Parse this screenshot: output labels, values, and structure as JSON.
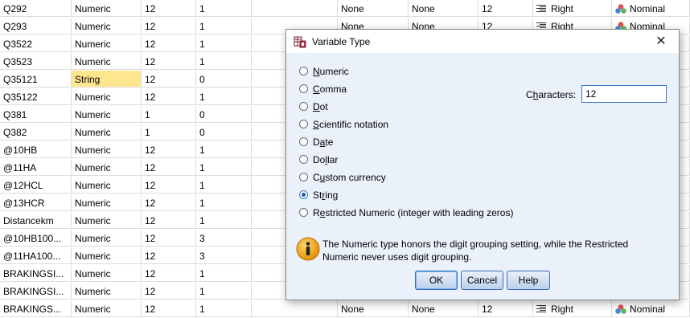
{
  "grid": {
    "rows": [
      {
        "name": "Q292",
        "type": "Numeric",
        "width": "12",
        "decimals": "1",
        "values": "None",
        "missing": "None",
        "columns": "12",
        "align": "Right",
        "measure": "Nominal"
      },
      {
        "name": "Q293",
        "type": "Numeric",
        "width": "12",
        "decimals": "1",
        "values": "None",
        "missing": "None",
        "columns": "12",
        "align": "Right",
        "measure": "Nominal"
      },
      {
        "name": "Q3522",
        "type": "Numeric",
        "width": "12",
        "decimals": "1"
      },
      {
        "name": "Q3523",
        "type": "Numeric",
        "width": "12",
        "decimals": "1"
      },
      {
        "name": "Q35121",
        "type": "String",
        "width": "12",
        "decimals": "0"
      },
      {
        "name": "Q35122",
        "type": "Numeric",
        "width": "12",
        "decimals": "1"
      },
      {
        "name": "Q381",
        "type": "Numeric",
        "width": "1",
        "decimals": "0"
      },
      {
        "name": "Q382",
        "type": "Numeric",
        "width": "1",
        "decimals": "0"
      },
      {
        "name": "@10HB",
        "type": "Numeric",
        "width": "12",
        "decimals": "1"
      },
      {
        "name": "@11HA",
        "type": "Numeric",
        "width": "12",
        "decimals": "1"
      },
      {
        "name": "@12HCL",
        "type": "Numeric",
        "width": "12",
        "decimals": "1"
      },
      {
        "name": "@13HCR",
        "type": "Numeric",
        "width": "12",
        "decimals": "1"
      },
      {
        "name": "Distancekm",
        "type": "Numeric",
        "width": "12",
        "decimals": "1"
      },
      {
        "name": "@10HB100...",
        "type": "Numeric",
        "width": "12",
        "decimals": "3"
      },
      {
        "name": "@11HA100...",
        "type": "Numeric",
        "width": "12",
        "decimals": "3"
      },
      {
        "name": "BRAKINGSI...",
        "type": "Numeric",
        "width": "12",
        "decimals": "1"
      },
      {
        "name": "BRAKINGSI...",
        "type": "Numeric",
        "width": "12",
        "decimals": "1"
      },
      {
        "name": "BRAKINGS...",
        "type": "Numeric",
        "width": "12",
        "decimals": "1",
        "values": "None",
        "missing": "None",
        "columns": "12",
        "align": "Right",
        "measure": "Nominal"
      }
    ]
  },
  "dialog": {
    "title": "Variable Type",
    "close_label": "✕",
    "options": [
      {
        "pre": "",
        "u": "N",
        "post": "umeric",
        "checked": false
      },
      {
        "pre": "",
        "u": "C",
        "post": "omma",
        "checked": false
      },
      {
        "pre": "",
        "u": "D",
        "post": "ot",
        "checked": false
      },
      {
        "pre": "",
        "u": "S",
        "post": "cientific notation",
        "checked": false
      },
      {
        "pre": "D",
        "u": "a",
        "post": "te",
        "checked": false
      },
      {
        "pre": "Do",
        "u": "l",
        "post": "lar",
        "checked": false
      },
      {
        "pre": "C",
        "u": "u",
        "post": "stom currency",
        "checked": false
      },
      {
        "pre": "St",
        "u": "r",
        "post": "ing",
        "checked": true
      },
      {
        "pre": "R",
        "u": "e",
        "post": "stricted Numeric (integer with leading zeros)",
        "checked": false
      }
    ],
    "characters_label_pre": "C",
    "characters_label_u": "h",
    "characters_label_post": "aracters:",
    "characters_value": "12",
    "info_text": "The Numeric type honors the digit grouping setting, while the Restricted Numeric never uses digit grouping.",
    "ok_label": "OK",
    "cancel_label": "Cancel",
    "help_label": "Help"
  },
  "colors": {
    "highlight": "#fde68e",
    "dialog_body": "#eaf1fb",
    "radio_selected": "#1a5fb4"
  }
}
